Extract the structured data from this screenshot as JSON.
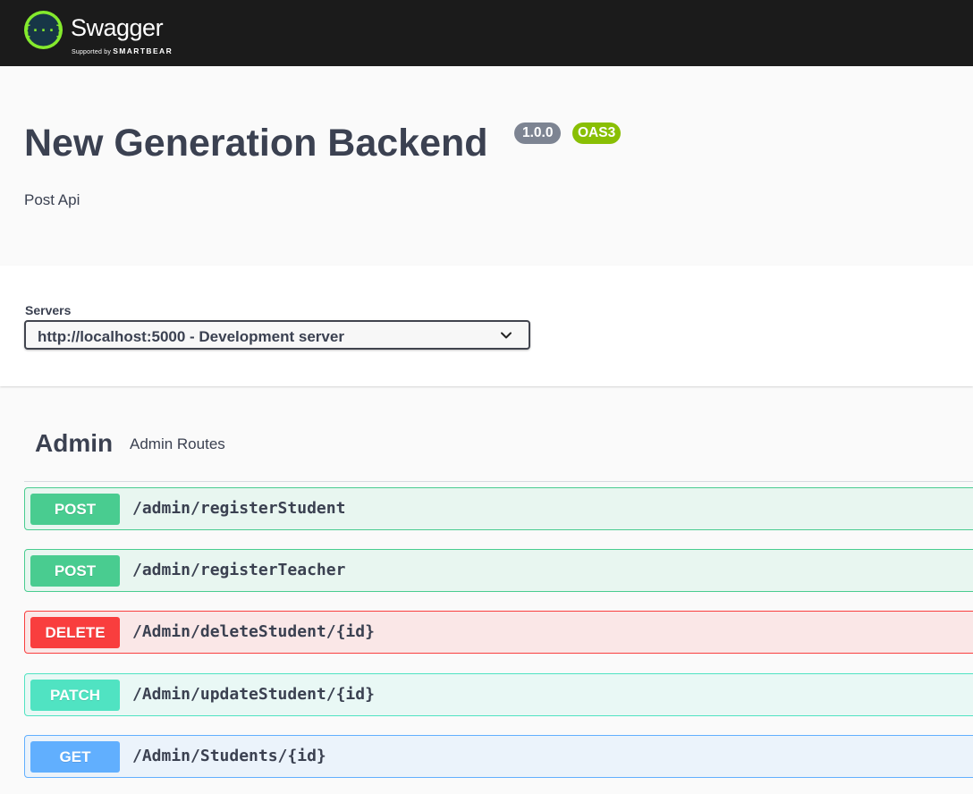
{
  "topbar": {
    "logo_text": "Swagger",
    "logo_supported": "Supported by",
    "logo_brand": "SMARTBEAR",
    "logo_icon": "swagger-braces-icon",
    "colors": {
      "background": "#1b1b1b",
      "logo_green": "#85ea2d"
    }
  },
  "info": {
    "title": "New Generation Backend",
    "version": "1.0.0",
    "oas": "OAS3",
    "description": "Post Api"
  },
  "servers": {
    "label": "Servers",
    "selected": "http://localhost:5000 - Development server"
  },
  "tag": {
    "name": "Admin",
    "description": "Admin Routes"
  },
  "operations": [
    {
      "method": "POST",
      "path": "/admin/registerStudent",
      "color": "#49cc90"
    },
    {
      "method": "POST",
      "path": "/admin/registerTeacher",
      "color": "#49cc90"
    },
    {
      "method": "DELETE",
      "path": "/Admin/deleteStudent/{id}",
      "color": "#f93e3e"
    },
    {
      "method": "PATCH",
      "path": "/Admin/updateStudent/{id}",
      "color": "#50e3c2"
    },
    {
      "method": "GET",
      "path": "/Admin/Students/{id}",
      "color": "#61affe"
    }
  ]
}
